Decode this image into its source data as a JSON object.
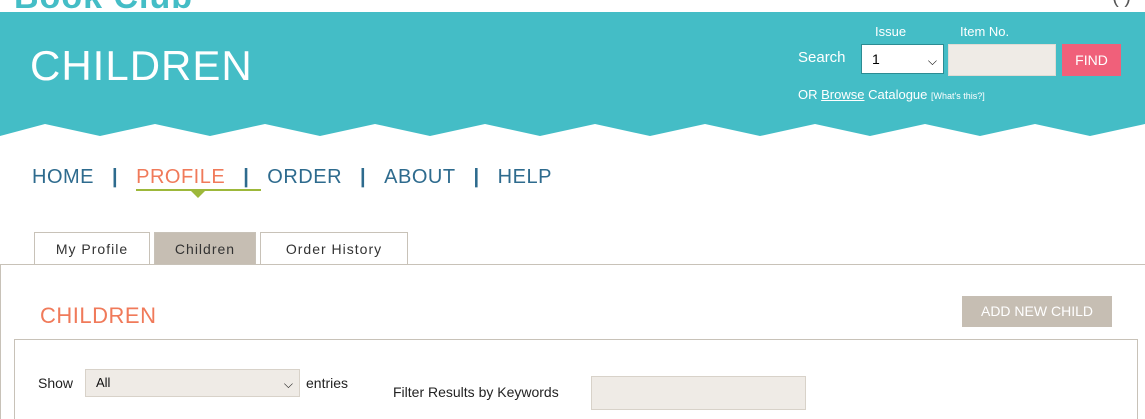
{
  "brand": {
    "logo_text": "Book Club",
    "right_text": "( )"
  },
  "banner": {
    "title": "CHILDREN",
    "search": {
      "issue_label": "Issue",
      "item_label": "Item No.",
      "search_label": "Search",
      "issue_value": "1",
      "item_placeholder": "",
      "find_label": "FIND",
      "or_text": "OR",
      "browse_link": "Browse",
      "catalogue_text": "Catalogue",
      "whats_this": "[What's this?]"
    }
  },
  "nav": {
    "items": [
      {
        "label": "HOME"
      },
      {
        "label": "PROFILE"
      },
      {
        "label": "ORDER"
      },
      {
        "label": "ABOUT"
      },
      {
        "label": "HELP"
      }
    ],
    "separator": "|",
    "active": "PROFILE"
  },
  "tabs": [
    {
      "label": "My Profile"
    },
    {
      "label": "Children"
    },
    {
      "label": "Order History"
    }
  ],
  "active_tab": "Children",
  "content": {
    "title": "CHILDREN",
    "add_button": "ADD NEW CHILD",
    "show_label": "Show",
    "entries_value": "All",
    "entries_label": "entries",
    "filter_label": "Filter Results by Keywords",
    "filter_value": ""
  },
  "colors": {
    "teal": "#44bdc6",
    "nav_blue": "#2e6b8e",
    "accent_orange": "#f07a5a",
    "find_pink": "#f0607a",
    "tab_active": "#c6beb3",
    "active_underline": "#9db83a"
  },
  "icons": {
    "select_arrow": "chevron-down-icon"
  }
}
